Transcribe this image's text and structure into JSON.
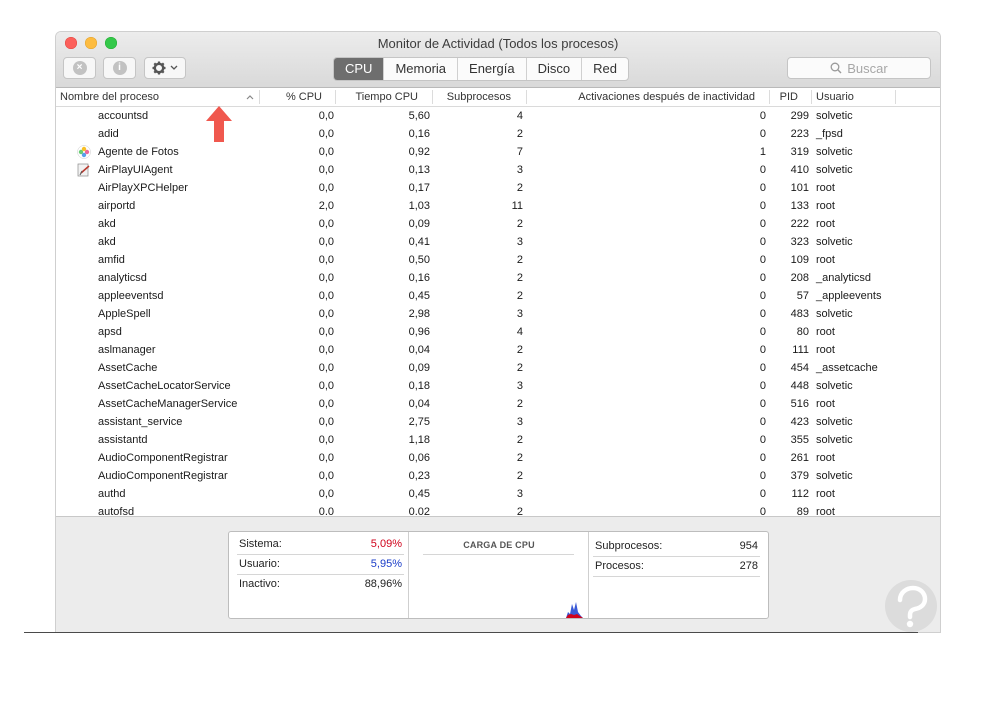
{
  "window": {
    "title": "Monitor de Actividad (Todos los procesos)"
  },
  "tabs": [
    {
      "label": "CPU",
      "active": true
    },
    {
      "label": "Memoria",
      "active": false
    },
    {
      "label": "Energía",
      "active": false
    },
    {
      "label": "Disco",
      "active": false
    },
    {
      "label": "Red",
      "active": false
    }
  ],
  "search": {
    "placeholder": "Buscar"
  },
  "columns": {
    "name": "Nombre del proceso",
    "cpu": "% CPU",
    "time": "Tiempo CPU",
    "threads": "Subprocesos",
    "wakeups": "Activaciones después de inactividad",
    "pid": "PID",
    "user": "Usuario"
  },
  "processes": [
    {
      "name": "accountsd",
      "cpu": "0,0",
      "time": "5,60",
      "threads": "4",
      "wakeups": "0",
      "pid": "299",
      "user": "solvetic",
      "icon": ""
    },
    {
      "name": "adid",
      "cpu": "0,0",
      "time": "0,16",
      "threads": "2",
      "wakeups": "0",
      "pid": "223",
      "user": "_fpsd",
      "icon": ""
    },
    {
      "name": "Agente de Fotos",
      "cpu": "0,0",
      "time": "0,92",
      "threads": "7",
      "wakeups": "1",
      "pid": "319",
      "user": "solvetic",
      "icon": "photos-icon"
    },
    {
      "name": "AirPlayUIAgent",
      "cpu": "0,0",
      "time": "0,13",
      "threads": "3",
      "wakeups": "0",
      "pid": "410",
      "user": "solvetic",
      "icon": "airplay-app-icon"
    },
    {
      "name": "AirPlayXPCHelper",
      "cpu": "0,0",
      "time": "0,17",
      "threads": "2",
      "wakeups": "0",
      "pid": "101",
      "user": "root",
      "icon": ""
    },
    {
      "name": "airportd",
      "cpu": "2,0",
      "time": "1,03",
      "threads": "11",
      "wakeups": "0",
      "pid": "133",
      "user": "root",
      "icon": ""
    },
    {
      "name": "akd",
      "cpu": "0,0",
      "time": "0,09",
      "threads": "2",
      "wakeups": "0",
      "pid": "222",
      "user": "root",
      "icon": ""
    },
    {
      "name": "akd",
      "cpu": "0,0",
      "time": "0,41",
      "threads": "3",
      "wakeups": "0",
      "pid": "323",
      "user": "solvetic",
      "icon": ""
    },
    {
      "name": "amfid",
      "cpu": "0,0",
      "time": "0,50",
      "threads": "2",
      "wakeups": "0",
      "pid": "109",
      "user": "root",
      "icon": ""
    },
    {
      "name": "analyticsd",
      "cpu": "0,0",
      "time": "0,16",
      "threads": "2",
      "wakeups": "0",
      "pid": "208",
      "user": "_analyticsd",
      "icon": ""
    },
    {
      "name": "appleeventsd",
      "cpu": "0,0",
      "time": "0,45",
      "threads": "2",
      "wakeups": "0",
      "pid": "57",
      "user": "_appleevents",
      "icon": ""
    },
    {
      "name": "AppleSpell",
      "cpu": "0,0",
      "time": "2,98",
      "threads": "3",
      "wakeups": "0",
      "pid": "483",
      "user": "solvetic",
      "icon": ""
    },
    {
      "name": "apsd",
      "cpu": "0,0",
      "time": "0,96",
      "threads": "4",
      "wakeups": "0",
      "pid": "80",
      "user": "root",
      "icon": ""
    },
    {
      "name": "aslmanager",
      "cpu": "0,0",
      "time": "0,04",
      "threads": "2",
      "wakeups": "0",
      "pid": "111",
      "user": "root",
      "icon": ""
    },
    {
      "name": "AssetCache",
      "cpu": "0,0",
      "time": "0,09",
      "threads": "2",
      "wakeups": "0",
      "pid": "454",
      "user": "_assetcache",
      "icon": ""
    },
    {
      "name": "AssetCacheLocatorService",
      "cpu": "0,0",
      "time": "0,18",
      "threads": "3",
      "wakeups": "0",
      "pid": "448",
      "user": "solvetic",
      "icon": ""
    },
    {
      "name": "AssetCacheManagerService",
      "cpu": "0,0",
      "time": "0,04",
      "threads": "2",
      "wakeups": "0",
      "pid": "516",
      "user": "root",
      "icon": ""
    },
    {
      "name": "assistant_service",
      "cpu": "0,0",
      "time": "2,75",
      "threads": "3",
      "wakeups": "0",
      "pid": "423",
      "user": "solvetic",
      "icon": ""
    },
    {
      "name": "assistantd",
      "cpu": "0,0",
      "time": "1,18",
      "threads": "2",
      "wakeups": "0",
      "pid": "355",
      "user": "solvetic",
      "icon": ""
    },
    {
      "name": "AudioComponentRegistrar",
      "cpu": "0,0",
      "time": "0,06",
      "threads": "2",
      "wakeups": "0",
      "pid": "261",
      "user": "root",
      "icon": ""
    },
    {
      "name": "AudioComponentRegistrar",
      "cpu": "0,0",
      "time": "0,23",
      "threads": "2",
      "wakeups": "0",
      "pid": "379",
      "user": "solvetic",
      "icon": ""
    },
    {
      "name": "authd",
      "cpu": "0,0",
      "time": "0,45",
      "threads": "3",
      "wakeups": "0",
      "pid": "112",
      "user": "root",
      "icon": ""
    },
    {
      "name": "autofsd",
      "cpu": "0,0",
      "time": "0,02",
      "threads": "2",
      "wakeups": "0",
      "pid": "89",
      "user": "root",
      "icon": ""
    }
  ],
  "summary": {
    "sistema_label": "Sistema:",
    "sistema_value": "5,09%",
    "usuario_label": "Usuario:",
    "usuario_value": "5,95%",
    "inactivo_label": "Inactivo:",
    "inactivo_value": "88,96%",
    "cpu_load_title": "CARGA DE CPU",
    "threads_label": "Subprocesos:",
    "threads_value": "954",
    "processes_label": "Procesos:",
    "processes_value": "278"
  },
  "colors": {
    "system": "#d0021b",
    "user": "#1a3cc8",
    "active_tab": "#6e6e6e",
    "arrow": "#f0584e"
  }
}
